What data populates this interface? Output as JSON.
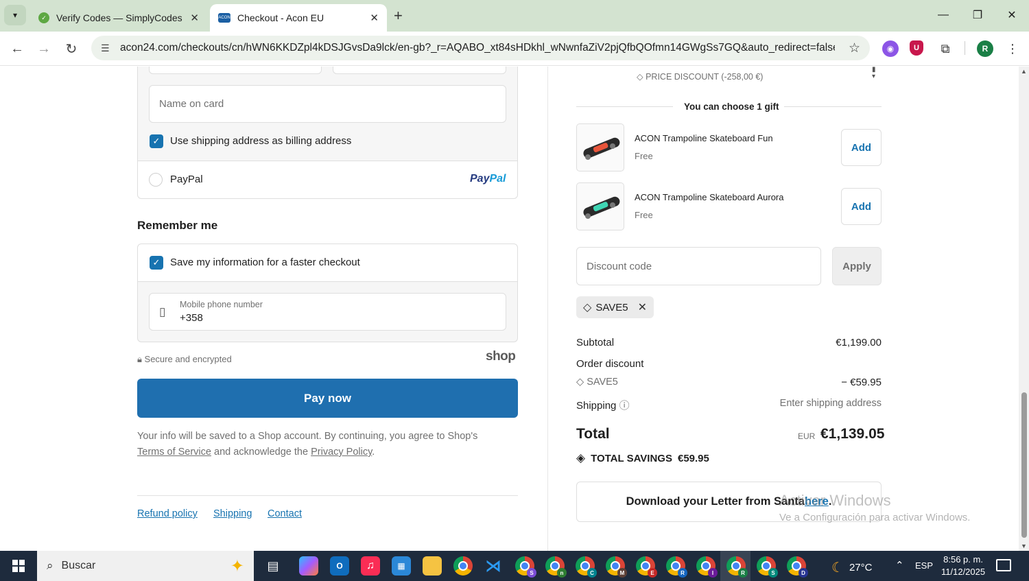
{
  "browser": {
    "tabs": [
      {
        "title": "Verify Codes — SimplyCodes",
        "active": false
      },
      {
        "title": "Checkout - Acon EU",
        "active": true
      }
    ],
    "url": "acon24.com/checkouts/cn/hWN6KKDZpl4kDSJGvsDa9lck/en-gb?_r=AQABO_xt84sHDkhl_wNwnfaZiV2pjQfbQOfmn14GWgSs7GQ&auto_redirect=false&...",
    "avatar_initial": "R"
  },
  "payment": {
    "name_on_card_placeholder": "Name on card",
    "billing_checkbox_label": "Use shipping address as billing address",
    "paypal_label": "PayPal",
    "paypal_logo_a": "Pay",
    "paypal_logo_b": "Pal"
  },
  "remember": {
    "heading": "Remember me",
    "save_info_label": "Save my information for a faster checkout",
    "phone_label": "Mobile phone number",
    "phone_value": "+358",
    "secure_text": "Secure and encrypted",
    "shop_logo": "shop"
  },
  "pay_button": "Pay now",
  "legal": {
    "text_1": "Your info will be saved to a Shop account. By continuing, you agree to Shop's",
    "terms": "Terms of Service",
    "text_2": " and acknowledge the ",
    "privacy": "Privacy Policy",
    "text_3": "."
  },
  "footer_links": [
    "Refund policy",
    "Shipping",
    "Contact"
  ],
  "summary": {
    "price_discount": "PRICE DISCOUNT (-258,00 €)",
    "gift_heading": "You can choose 1 gift",
    "gifts": [
      {
        "name": "ACON Trampoline Skateboard Fun",
        "price": "Free",
        "button": "Add"
      },
      {
        "name": "ACON Trampoline Skateboard Aurora",
        "price": "Free",
        "button": "Add"
      }
    ],
    "discount_placeholder": "Discount code",
    "apply_label": "Apply",
    "applied_code": "SAVE5",
    "subtotal_label": "Subtotal",
    "subtotal_value": "€1,199.00",
    "order_discount_label": "Order discount",
    "discount_code": "SAVE5",
    "discount_value": "− €59.95",
    "shipping_label": "Shipping",
    "shipping_value": "Enter shipping address",
    "total_label": "Total",
    "total_currency": "EUR",
    "total_value": "€1,139.05",
    "savings_label": "TOTAL SAVINGS",
    "savings_value": "€59.95",
    "santa_text": "Download your Letter from Santa ",
    "santa_link": "here",
    "santa_end": "."
  },
  "watermark": {
    "line1": "Activar Windows",
    "line2": "Ve a Configuración para activar Windows."
  },
  "taskbar": {
    "search_placeholder": "Buscar",
    "temperature": "27°C",
    "language": "ESP",
    "time": "8:56 p. m.",
    "date": "11/12/2025",
    "chrome_profiles": [
      "S",
      "n",
      "C",
      "M",
      "E",
      "R",
      "I",
      "R",
      "S",
      "D"
    ]
  },
  "colors": {
    "accent": "#1773b0",
    "pay_button": "#1f6faf",
    "tabstrip": "#d3e3d0"
  }
}
